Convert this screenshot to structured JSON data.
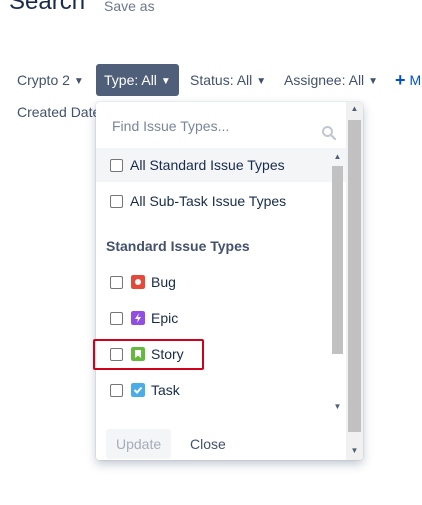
{
  "header": {
    "title": "Search",
    "save_as": "Save as"
  },
  "filters": {
    "project": "Crypto 2",
    "type": "Type: All",
    "status": "Status: All",
    "assignee": "Assignee: All",
    "more": "M",
    "created_date": "Created Date"
  },
  "dropdown": {
    "search_placeholder": "Find Issue Types...",
    "groups": [
      "All Standard Issue Types",
      "All Sub-Task Issue Types"
    ],
    "section_heading": "Standard Issue Types",
    "types": [
      {
        "label": "Bug",
        "icon": "bug-icon",
        "color": "#e5493a"
      },
      {
        "label": "Epic",
        "icon": "epic-icon",
        "color": "#904ee2"
      },
      {
        "label": "Story",
        "icon": "story-icon",
        "color": "#63ba3c"
      },
      {
        "label": "Task",
        "icon": "task-icon",
        "color": "#4bade8"
      }
    ],
    "update_label": "Update",
    "close_label": "Close"
  },
  "colors": {
    "active_filter": "#505f79",
    "link": "#0052cc",
    "highlight": "#d0021b"
  }
}
